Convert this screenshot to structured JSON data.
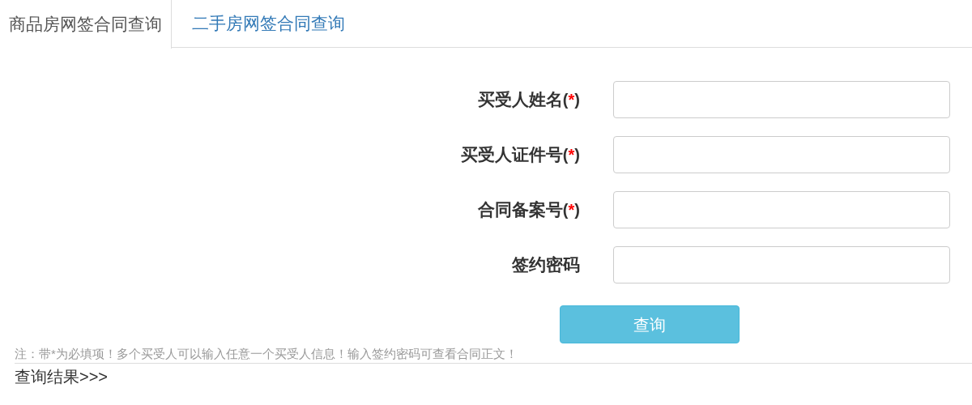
{
  "tabs": [
    {
      "label": "商品房网签合同查询",
      "selected": true
    },
    {
      "label": "二手房网签合同查询",
      "selected": false
    }
  ],
  "form": {
    "fields": [
      {
        "label": "买受人姓名",
        "required": true
      },
      {
        "label": "买受人证件号",
        "required": true
      },
      {
        "label": "合同备案号",
        "required": true
      },
      {
        "label": "签约密码",
        "required": false
      }
    ],
    "required_mark": "(*)",
    "submit": "查询"
  },
  "note": "注：带*为必填项！多个买受人可以输入任意一个买受人信息！输入签约密码可查看合同正文！",
  "result_heading": "查询结果>>>"
}
